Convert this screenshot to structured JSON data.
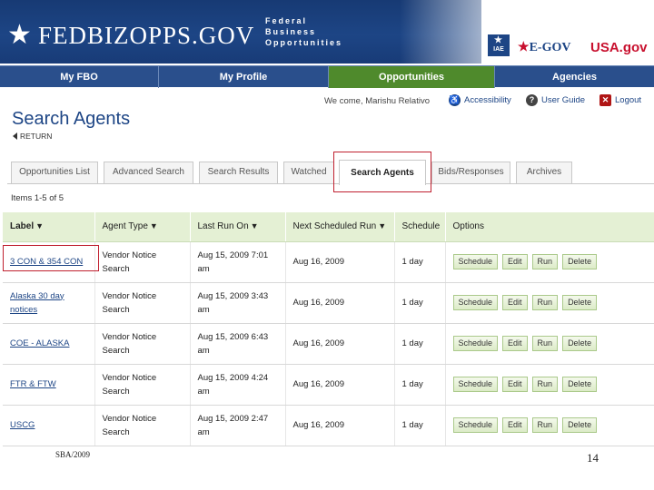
{
  "header": {
    "logo_text": "FEDBIZOPPS.GOV",
    "logo_sub": [
      "Federal",
      "Business",
      "Opportunities"
    ],
    "iae_badge": "IAE",
    "egov": "E-GOV",
    "usagov_left": "USA",
    "usagov_right": ".gov"
  },
  "nav": {
    "items": [
      {
        "label": "My FBO"
      },
      {
        "label": "My Profile"
      },
      {
        "label": "Opportunities"
      },
      {
        "label": "Agencies"
      }
    ]
  },
  "utility": {
    "welcome": "We come, Marishu Relativo",
    "accessibility": "Accessibility",
    "user_guide": "User Guide",
    "logout": "Logout"
  },
  "page": {
    "title": "Search Agents",
    "return": "RETURN",
    "items_count": "Items 1-5 of 5"
  },
  "tabs": [
    {
      "label": "Opportunities List"
    },
    {
      "label": "Advanced Search"
    },
    {
      "label": "Search Results"
    },
    {
      "label": "Watched"
    },
    {
      "label": "Search Agents"
    },
    {
      "label": "Bids/Responses"
    },
    {
      "label": "Archives"
    }
  ],
  "table": {
    "headers": [
      "Label",
      "Agent Type",
      "Last Run On",
      "Next Scheduled Run",
      "Schedule",
      "Options"
    ],
    "buttons": [
      "Schedule",
      "Edit",
      "Run",
      "Delete"
    ],
    "rows": [
      {
        "label": "3 CON & 354 CON",
        "agent_type": "Vendor Notice Search",
        "last_run": "Aug 15, 2009 7:01 am",
        "next_run": "Aug 16, 2009",
        "schedule": "1 day"
      },
      {
        "label": "Alaska 30 day notices",
        "agent_type": "Vendor Notice Search",
        "last_run": "Aug 15, 2009 3:43 am",
        "next_run": "Aug 16, 2009",
        "schedule": "1 day"
      },
      {
        "label": "COE - ALASKA",
        "agent_type": "Vendor Notice Search",
        "last_run": "Aug 15, 2009 6:43 am",
        "next_run": "Aug 16, 2009",
        "schedule": "1 day"
      },
      {
        "label": "FTR & FTW",
        "agent_type": "Vendor Notice Search",
        "last_run": "Aug 15, 2009 4:24 am",
        "next_run": "Aug 16, 2009",
        "schedule": "1 day"
      },
      {
        "label": "USCG",
        "agent_type": "Vendor Notice Search",
        "last_run": "Aug 15, 2009 2:47 am",
        "next_run": "Aug 16, 2009",
        "schedule": "1 day"
      }
    ]
  },
  "footer": {
    "left": "SBA/2009",
    "page_number": "14"
  }
}
